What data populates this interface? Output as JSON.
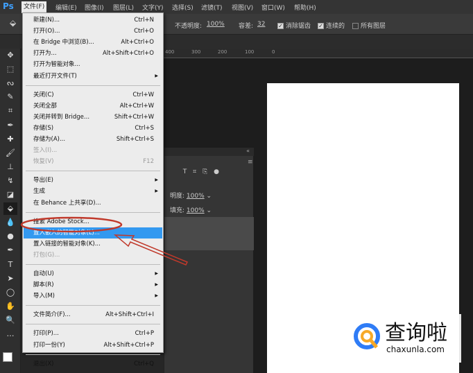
{
  "app": {
    "logo": "Ps"
  },
  "menubar": [
    "文件(F)",
    "编辑(E)",
    "图像(I)",
    "图层(L)",
    "文字(Y)",
    "选择(S)",
    "滤镜(T)",
    "视图(V)",
    "窗口(W)",
    "帮助(H)"
  ],
  "options": {
    "opacity_label": "不透明度:",
    "opacity": "100%",
    "tolerance_label": "容差:",
    "tolerance": "32",
    "antialias": "消除锯齿",
    "antialias_checked": true,
    "contiguous": "连续的",
    "contiguous_checked": true,
    "all_layers": "所有图层",
    "all_layers_checked": false
  },
  "ruler": [
    "400",
    "300",
    "200",
    "100",
    "0"
  ],
  "panel": {
    "opacity_label": "明度:",
    "opacity": "100%",
    "fill_label": "填充:",
    "fill": "100%"
  },
  "file_menu": [
    {
      "label": "新建(N)...",
      "shortcut": "Ctrl+N"
    },
    {
      "label": "打开(O)...",
      "shortcut": "Ctrl+O"
    },
    {
      "label": "在 Bridge 中浏览(B)...",
      "shortcut": "Alt+Ctrl+O"
    },
    {
      "label": "打开为...",
      "shortcut": "Alt+Shift+Ctrl+O"
    },
    {
      "label": "打开为智能对象..."
    },
    {
      "label": "最近打开文件(T)",
      "submenu": true
    },
    {
      "sep": true
    },
    {
      "label": "关闭(C)",
      "shortcut": "Ctrl+W"
    },
    {
      "label": "关闭全部",
      "shortcut": "Alt+Ctrl+W"
    },
    {
      "label": "关闭并转到 Bridge...",
      "shortcut": "Shift+Ctrl+W"
    },
    {
      "label": "存储(S)",
      "shortcut": "Ctrl+S"
    },
    {
      "label": "存储为(A)...",
      "shortcut": "Shift+Ctrl+S"
    },
    {
      "label": "签入(I)...",
      "disabled": true
    },
    {
      "label": "恢复(V)",
      "shortcut": "F12",
      "disabled": true
    },
    {
      "sep": true
    },
    {
      "label": "导出(E)",
      "submenu": true
    },
    {
      "label": "生成",
      "submenu": true
    },
    {
      "label": "在 Behance 上共享(D)..."
    },
    {
      "sep": true
    },
    {
      "label": "搜索 Adobe Stock..."
    },
    {
      "label": "置入嵌入的智能对象(L)...",
      "highlighted": true
    },
    {
      "label": "置入链接的智能对象(K)..."
    },
    {
      "label": "打包(G)...",
      "disabled": true
    },
    {
      "sep": true
    },
    {
      "label": "自动(U)",
      "submenu": true
    },
    {
      "label": "脚本(R)",
      "submenu": true
    },
    {
      "label": "导入(M)",
      "submenu": true
    },
    {
      "sep": true
    },
    {
      "label": "文件简介(F)...",
      "shortcut": "Alt+Shift+Ctrl+I"
    },
    {
      "sep": true
    },
    {
      "label": "打印(P)...",
      "shortcut": "Ctrl+P"
    },
    {
      "label": "打印一份(Y)",
      "shortcut": "Alt+Shift+Ctrl+P"
    },
    {
      "sep": true
    },
    {
      "label": "退出(X)",
      "shortcut": "Ctrl+Q"
    }
  ],
  "tools": [
    "move",
    "marquee",
    "lasso",
    "quick-select",
    "crop",
    "eyedropper",
    "healing",
    "brush",
    "stamp",
    "history-brush",
    "eraser",
    "paint-bucket",
    "blur",
    "dodge",
    "pen",
    "type",
    "path-select",
    "ellipse",
    "hand",
    "zoom",
    "more"
  ],
  "watermark": {
    "name": "查询啦",
    "domain": "chaxunla.com"
  },
  "colors": {
    "highlight": "#3399f0",
    "annotation": "#c0392b"
  }
}
